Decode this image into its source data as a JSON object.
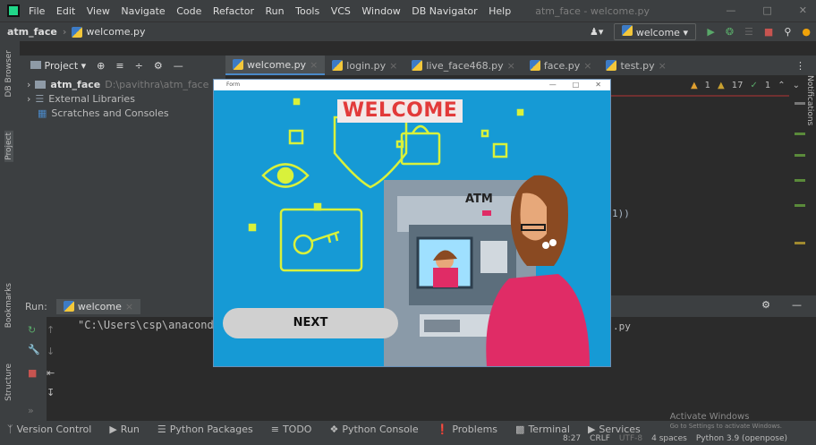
{
  "menu": {
    "items": [
      "File",
      "Edit",
      "View",
      "Navigate",
      "Code",
      "Refactor",
      "Run",
      "Tools",
      "VCS",
      "Window",
      "DB Navigator",
      "Help"
    ],
    "window_title": "atm_face - welcome.py"
  },
  "navbar": {
    "project": "atm_face",
    "file": "welcome.py",
    "run_config": "welcome"
  },
  "project_header": {
    "label": "Project"
  },
  "tree": {
    "root_name": "atm_face",
    "root_path": "D:\\pavithra\\atm_face",
    "external": "External Libraries",
    "scratches": "Scratches and Consoles"
  },
  "tabs": [
    "welcome.py",
    "login.py",
    "live_face468.py",
    "face.py",
    "test.py"
  ],
  "inspections": {
    "warn1": "1",
    "warn2": "17",
    "ok": "1"
  },
  "editor": {
    "code_fragment": "1))"
  },
  "side_labels": {
    "db_browser": "DB Browser",
    "project": "Project",
    "bookmarks": "Bookmarks",
    "structure": "Structure",
    "notifications": "Notifications"
  },
  "run": {
    "label": "Run:",
    "tab": "welcome",
    "command": "\"C:\\Users\\csp\\anaconda:",
    "command_tail": ".py"
  },
  "bottom_tools": [
    "Version Control",
    "Run",
    "Python Packages",
    "TODO",
    "Python Console",
    "Problems",
    "Terminal",
    "Services"
  ],
  "activate": {
    "title": "Activate Windows",
    "sub": "Go to Settings to activate Windows."
  },
  "status": {
    "pos": "8:27",
    "eol": "CRLF",
    "enc": "UTF-8",
    "indent": "4 spaces",
    "interpreter": "Python 3.9 (openpose)"
  },
  "tk": {
    "title": "Form",
    "welcome": "WELCOME",
    "atm": "ATM",
    "next": "NEXT"
  },
  "colors": {
    "ide_bg": "#2b2b2b",
    "panel_bg": "#3c3f41",
    "tk_canvas": "#169ad5",
    "welcome_text": "#e23a3a"
  }
}
